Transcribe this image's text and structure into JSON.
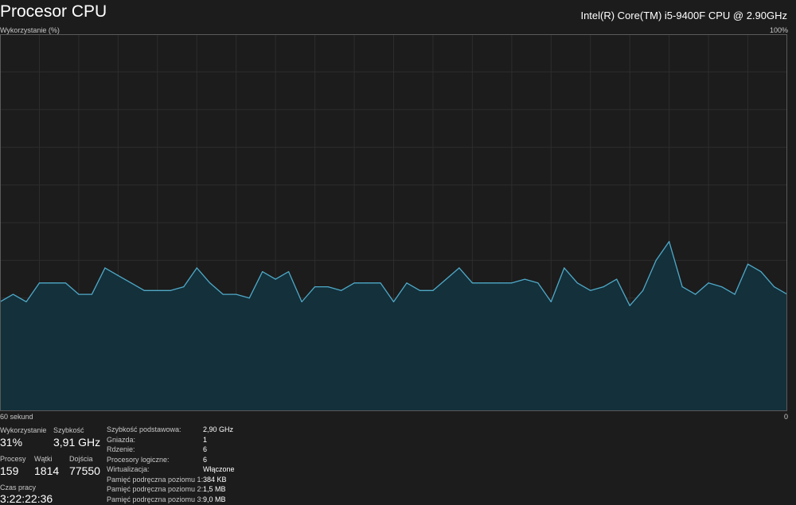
{
  "header": {
    "title": "Procesor CPU",
    "cpu_model": "Intel(R) Core(TM) i5-9400F CPU @ 2.90GHz"
  },
  "graph": {
    "y_label": "Wykorzystanie (%)",
    "y_max_label": "100%",
    "x_label": "60 sekund",
    "x_min_label": "0"
  },
  "stats": {
    "usage_label": "Wykorzystanie",
    "usage_value": "31%",
    "speed_label": "Szybkość",
    "speed_value": "3,91 GHz",
    "processes_label": "Procesy",
    "processes_value": "159",
    "threads_label": "Wątki",
    "threads_value": "1814",
    "handles_label": "Dojścia",
    "handles_value": "77550",
    "uptime_label": "Czas pracy",
    "uptime_value": "3:22:22:36"
  },
  "details": [
    {
      "key": "Szybkość podstawowa:",
      "value": "2,90 GHz"
    },
    {
      "key": "Gniazda:",
      "value": "1"
    },
    {
      "key": "Rdzenie:",
      "value": "6"
    },
    {
      "key": "Procesory logiczne:",
      "value": "6"
    },
    {
      "key": "Wirtualizacja:",
      "value": "Włączone"
    },
    {
      "key": "Pamięć podręczna poziomu 1:",
      "value": "384 KB"
    },
    {
      "key": "Pamięć podręczna poziomu 2:",
      "value": "1,5 MB"
    },
    {
      "key": "Pamięć podręczna poziomu 3:",
      "value": "9,0 MB"
    }
  ],
  "colors": {
    "background": "#1c1c1c",
    "grid": "#2d2d2d",
    "border": "#5a5a5a",
    "line": "#4fa9c8",
    "fill": "#13303b"
  },
  "chart_data": {
    "type": "area",
    "x": [
      60,
      59,
      58,
      57,
      56,
      55,
      54,
      53,
      52,
      51,
      50,
      49,
      48,
      47,
      46,
      45,
      44,
      43,
      42,
      41,
      40,
      39,
      38,
      37,
      36,
      35,
      34,
      33,
      32,
      31,
      30,
      29,
      28,
      27,
      26,
      25,
      24,
      23,
      22,
      21,
      20,
      19,
      18,
      17,
      16,
      15,
      14,
      13,
      12,
      11,
      10,
      9,
      8,
      7,
      6,
      5,
      4,
      3,
      2,
      1,
      0
    ],
    "values": [
      29,
      31,
      29,
      34,
      34,
      34,
      31,
      31,
      38,
      36,
      34,
      32,
      32,
      32,
      33,
      38,
      34,
      31,
      31,
      30,
      37,
      35,
      37,
      29,
      33,
      33,
      32,
      34,
      34,
      34,
      29,
      34,
      32,
      32,
      35,
      38,
      34,
      34,
      34,
      34,
      35,
      34,
      29,
      38,
      34,
      32,
      33,
      35,
      28,
      32,
      40,
      45,
      33,
      31,
      34,
      33,
      31,
      39,
      37,
      33,
      31
    ],
    "ylim": [
      0,
      100
    ],
    "xlim": [
      60,
      0
    ],
    "grid": true,
    "grid_rows": 10,
    "grid_cols": 20
  }
}
